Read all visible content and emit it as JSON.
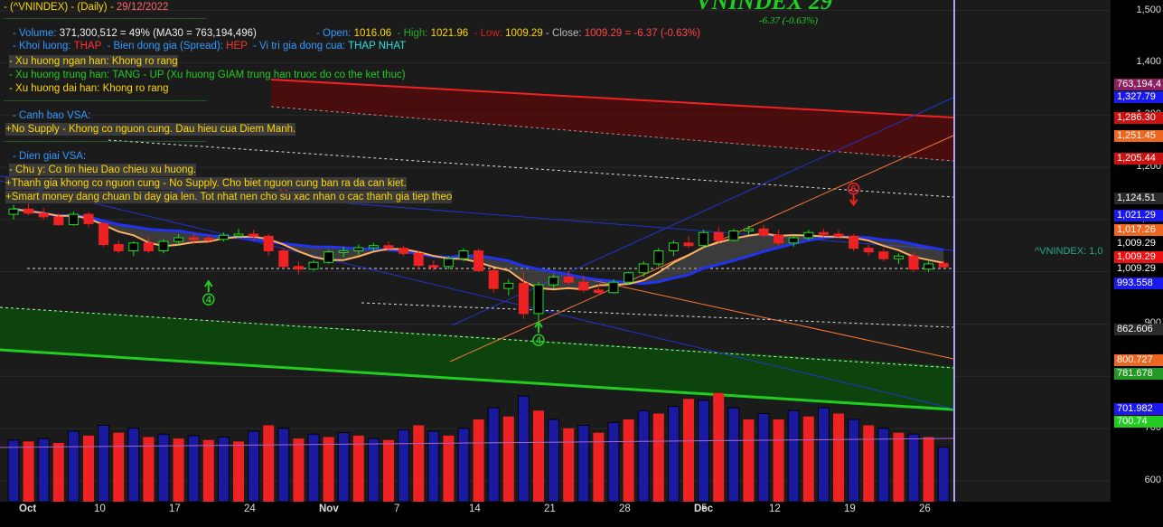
{
  "colors": {
    "background": "#1b1b1b",
    "up": "#22dd22",
    "down": "#ee2222",
    "ma_short": "#ffb060",
    "ma_long": "#2233ee",
    "channel_blue": "#2233cc",
    "channel_orange": "#ff7733",
    "resist_red": "#ee2222",
    "support_green": "#22cc22",
    "volume_up": "#1a1aa0",
    "volume_down": "#ee2222"
  },
  "header": {
    "symbol": "- (^VNINDEX) - (Daily) -",
    "date": "29/12/2022",
    "big_value": "VNINDEX 29",
    "change": "-6.37 (-0.63%)",
    "dashes": "---------------------------------------------------------------------------"
  },
  "info": {
    "volume_label": "- Volume:",
    "volume_value": "371,300,512 = 49%",
    "ma30": "(MA30 = 763,194,496)",
    "open_label": "- Open:",
    "open_value": "1016.06",
    "high_label": "- High:",
    "high_value": "1021.96",
    "low_label": "- Low:",
    "low_value": "1009.29",
    "close_label": "- Close:",
    "close_value": "1009.29 = -6.37 (-0.63%)",
    "khoi_luong_label": "- Khoi luong:",
    "khoi_luong_value": "THAP",
    "bien_dong_label": "- Bien dong gia (Spread):",
    "bien_dong_value": "HEP",
    "vi_tri_label": "- Vi tri gia dong cua:",
    "vi_tri_value": "THAP NHAT",
    "trend_short": "-  Xu huong ngan han: Khong ro rang",
    "trend_mid_label": "-  Xu huong trung han: TANG - UP",
    "trend_mid_note": "(Xu huong GIAM trung han truoc do co the ket thuc)",
    "trend_long": "-  Xu huong dai han:     Khong ro rang",
    "canh_bao_label": "- Canh bao VSA:",
    "canh_bao_text": "+No Supply - Khong co nguon cung. Dau hieu cua Diem Manh.",
    "dien_giai_label": "- Dien giai VSA:",
    "dien_giai_1": "- Chu y: Co tin hieu Dao chieu xu huong.",
    "dien_giai_2": "+Thanh gia khong co nguon cung - No Supply. Cho biet nguon cung ban ra da can kiet.",
    "dien_giai_3": "+Smart money dang chuan bi day gia len. Tot nhat nen cho su xac nhan o cac thanh gia tiep theo"
  },
  "series_label": "^VNINDEX: 1,0",
  "signals": [
    {
      "label": "4",
      "kind": "up"
    },
    {
      "label": "4",
      "kind": "up"
    },
    {
      "label": "6",
      "kind": "down"
    },
    {
      "label": "6",
      "kind": "down"
    }
  ],
  "chart_data": {
    "type": "candlestick",
    "title": "VNINDEX (Daily)",
    "ylim": [
      560,
      1520
    ],
    "y_ticks": [
      "1,500",
      "1,400",
      "1,300",
      "1,200",
      "1,100",
      "1,009.29",
      "900",
      "800",
      "700",
      "600"
    ],
    "price_labels": [
      {
        "text": "763,194,4",
        "bg": "#8a2060"
      },
      {
        "text": "1,327.79",
        "bg": "#1a1aee"
      },
      {
        "text": "1,286.30",
        "bg": "#cc1111"
      },
      {
        "text": "1,251.45",
        "bg": "#ee6622"
      },
      {
        "text": "1,205.44",
        "bg": "#cc1111"
      },
      {
        "text": "1,124.51",
        "bg": "#2a2a2a"
      },
      {
        "text": "1,021.29",
        "bg": "#1a1aee"
      },
      {
        "text": "1,017.26",
        "bg": "#ee6622"
      },
      {
        "text": "1,009.29",
        "bg": "#000000"
      },
      {
        "text": "1,009.29",
        "bg": "#ee1111"
      },
      {
        "text": "1,009.29",
        "bg": "#000000"
      },
      {
        "text": "993.558",
        "bg": "#1a1aee"
      },
      {
        "text": "862.606",
        "bg": "#2a2a2a"
      },
      {
        "text": "800.727",
        "bg": "#ee6622"
      },
      {
        "text": "781.678",
        "bg": "#229922"
      },
      {
        "text": "701.982",
        "bg": "#1a1aee"
      },
      {
        "text": "700.74",
        "bg": "#22cc22"
      }
    ],
    "x_labels": [
      {
        "text": "Oct",
        "bold": true
      },
      {
        "text": "10",
        "bold": false
      },
      {
        "text": "17",
        "bold": false
      },
      {
        "text": "24",
        "bold": false
      },
      {
        "text": "Nov",
        "bold": true
      },
      {
        "text": "7",
        "bold": false
      },
      {
        "text": "14",
        "bold": false
      },
      {
        "text": "21",
        "bold": false
      },
      {
        "text": "28",
        "bold": false
      },
      {
        "text": "Dec",
        "bold": true
      },
      {
        "text": "5",
        "bold": false
      },
      {
        "text": "12",
        "bold": false
      },
      {
        "text": "19",
        "bold": false
      },
      {
        "text": "26",
        "bold": false
      }
    ],
    "x_label_bar_index": [
      0,
      5,
      10,
      15,
      20,
      25,
      30,
      35,
      40,
      45,
      45.5,
      50,
      55,
      60
    ],
    "candles": [
      [
        1110,
        1128,
        1100,
        1120
      ],
      [
        1120,
        1130,
        1108,
        1112
      ],
      [
        1112,
        1122,
        1100,
        1105
      ],
      [
        1105,
        1112,
        1088,
        1090
      ],
      [
        1090,
        1115,
        1088,
        1110
      ],
      [
        1110,
        1115,
        1085,
        1092
      ],
      [
        1092,
        1095,
        1048,
        1052
      ],
      [
        1052,
        1060,
        1035,
        1040
      ],
      [
        1040,
        1058,
        1030,
        1055
      ],
      [
        1055,
        1068,
        1035,
        1040
      ],
      [
        1040,
        1062,
        1035,
        1058
      ],
      [
        1058,
        1072,
        1050,
        1065
      ],
      [
        1065,
        1075,
        1052,
        1064
      ],
      [
        1064,
        1070,
        1055,
        1062
      ],
      [
        1062,
        1075,
        1058,
        1070
      ],
      [
        1070,
        1082,
        1065,
        1072
      ],
      [
        1072,
        1080,
        1060,
        1068
      ],
      [
        1068,
        1072,
        1030,
        1040
      ],
      [
        1040,
        1045,
        1005,
        1010
      ],
      [
        1010,
        1020,
        995,
        1005
      ],
      [
        1005,
        1022,
        1002,
        1018
      ],
      [
        1018,
        1042,
        1015,
        1038
      ],
      [
        1038,
        1048,
        1028,
        1040
      ],
      [
        1040,
        1052,
        1032,
        1046
      ],
      [
        1046,
        1055,
        1040,
        1050
      ],
      [
        1050,
        1058,
        1040,
        1045
      ],
      [
        1045,
        1050,
        1030,
        1035
      ],
      [
        1035,
        1040,
        1005,
        1012
      ],
      [
        1012,
        1022,
        1002,
        1010
      ],
      [
        1010,
        1030,
        1005,
        1025
      ],
      [
        1025,
        1045,
        1020,
        1040
      ],
      [
        1040,
        1044,
        1000,
        1002
      ],
      [
        1002,
        1005,
        960,
        968
      ],
      [
        968,
        985,
        955,
        978
      ],
      [
        978,
        1000,
        910,
        920
      ],
      [
        920,
        980,
        900,
        975
      ],
      [
        975,
        995,
        968,
        990
      ],
      [
        990,
        1002,
        975,
        980
      ],
      [
        980,
        992,
        960,
        965
      ],
      [
        965,
        975,
        955,
        960
      ],
      [
        960,
        985,
        958,
        980
      ],
      [
        980,
        1000,
        975,
        998
      ],
      [
        998,
        1020,
        990,
        1015
      ],
      [
        1015,
        1045,
        1010,
        1040
      ],
      [
        1040,
        1060,
        1030,
        1055
      ],
      [
        1055,
        1068,
        1045,
        1050
      ],
      [
        1050,
        1080,
        1045,
        1075
      ],
      [
        1075,
        1085,
        1055,
        1060
      ],
      [
        1060,
        1082,
        1058,
        1078
      ],
      [
        1078,
        1088,
        1070,
        1082
      ],
      [
        1082,
        1090,
        1065,
        1070
      ],
      [
        1070,
        1080,
        1050,
        1055
      ],
      [
        1055,
        1070,
        1048,
        1065
      ],
      [
        1065,
        1080,
        1060,
        1075
      ],
      [
        1075,
        1082,
        1066,
        1072
      ],
      [
        1072,
        1080,
        1062,
        1068
      ],
      [
        1068,
        1072,
        1040,
        1045
      ],
      [
        1045,
        1052,
        1030,
        1038
      ],
      [
        1038,
        1045,
        1020,
        1025
      ],
      [
        1025,
        1035,
        1015,
        1030
      ],
      [
        1030,
        1038,
        1000,
        1005
      ],
      [
        1005,
        1020,
        1000,
        1015
      ],
      [
        1016.06,
        1021.96,
        1009.29,
        1009.29
      ]
    ],
    "volume_max": 800,
    "volume": [
      [
        420,
        1
      ],
      [
        410,
        0
      ],
      [
        430,
        1
      ],
      [
        400,
        0
      ],
      [
        480,
        1
      ],
      [
        450,
        0
      ],
      [
        520,
        1
      ],
      [
        470,
        0
      ],
      [
        500,
        1
      ],
      [
        440,
        0
      ],
      [
        460,
        1
      ],
      [
        430,
        0
      ],
      [
        450,
        1
      ],
      [
        420,
        0
      ],
      [
        440,
        1
      ],
      [
        410,
        0
      ],
      [
        480,
        1
      ],
      [
        520,
        0
      ],
      [
        500,
        1
      ],
      [
        430,
        0
      ],
      [
        460,
        1
      ],
      [
        440,
        0
      ],
      [
        470,
        1
      ],
      [
        450,
        0
      ],
      [
        430,
        1
      ],
      [
        420,
        0
      ],
      [
        490,
        1
      ],
      [
        520,
        0
      ],
      [
        480,
        1
      ],
      [
        450,
        0
      ],
      [
        500,
        1
      ],
      [
        560,
        0
      ],
      [
        640,
        1
      ],
      [
        580,
        0
      ],
      [
        720,
        1
      ],
      [
        620,
        0
      ],
      [
        560,
        1
      ],
      [
        500,
        0
      ],
      [
        520,
        1
      ],
      [
        470,
        0
      ],
      [
        540,
        1
      ],
      [
        560,
        0
      ],
      [
        620,
        1
      ],
      [
        600,
        0
      ],
      [
        650,
        1
      ],
      [
        700,
        0
      ],
      [
        690,
        1
      ],
      [
        740,
        0
      ],
      [
        640,
        1
      ],
      [
        560,
        0
      ],
      [
        600,
        1
      ],
      [
        560,
        0
      ],
      [
        620,
        1
      ],
      [
        580,
        0
      ],
      [
        640,
        1
      ],
      [
        600,
        0
      ],
      [
        560,
        1
      ],
      [
        520,
        0
      ],
      [
        500,
        1
      ],
      [
        470,
        0
      ],
      [
        460,
        1
      ],
      [
        440,
        0
      ],
      [
        371,
        1
      ]
    ]
  }
}
